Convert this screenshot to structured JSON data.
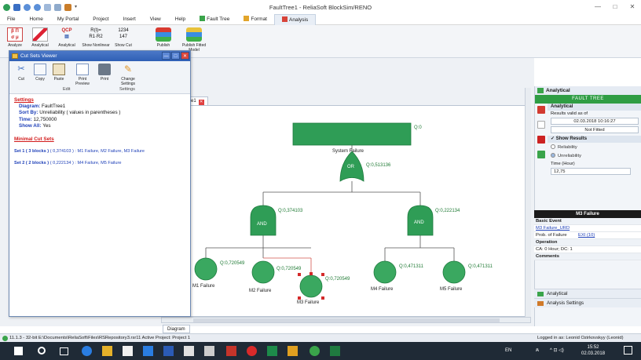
{
  "window": {
    "title": "FaultTree1 - ReliaSoft BlockSim/RENO",
    "minimize": "—",
    "maximize": "□",
    "close": "✕"
  },
  "ribbon_tabs": [
    "File",
    "Home",
    "My Portal",
    "Project",
    "Insert",
    "View",
    "Help",
    "Fault Tree",
    "Format",
    "Analysis"
  ],
  "ribbon": {
    "buttons": [
      "Analyze",
      "Analytical",
      "Analytical",
      "Show Nonlinear",
      "Show Cut",
      "Publish",
      "Publish Fitted Model"
    ],
    "qcp_label": "QCP",
    "formula_top": "R(t)=",
    "formula_bottom": "R1·R2",
    "num_top": "1234",
    "num_bottom": "147"
  },
  "doc_tab": "tree1",
  "doc_tab_close": "✕",
  "bottom_tab": "Diagram",
  "cut_sets_viewer": {
    "title": "Cut Sets Viewer",
    "tools": [
      "Cut",
      "Copy",
      "Paste",
      "Print Preview",
      "Print",
      "Change Settings"
    ],
    "group_edit": "Edit",
    "group_settings": "Settings",
    "settings_header": "Settings",
    "diagram_label": "Diagram:",
    "diagram_value": "FaultTree1",
    "sort_label": "Sort By:",
    "sort_value": "Unreliability ( values in parentheses )",
    "time_label": "Time:",
    "time_value": "12,750000",
    "showall_label": "Show All:",
    "showall_value": "Yes",
    "mcs_header": "Minimal Cut Sets",
    "set1_head": "Set 1 ( 3 blocks )",
    "set1_rest": " ( 0,374103 ) : M1 Failure, M2 Failure, M3 Failure",
    "set2_head": "Set 2 ( 2 blocks )",
    "set2_rest": " ( 0,222134 ) : M4 Failure, M5 Failure"
  },
  "fault_tree": {
    "top_q": "Q:0",
    "top_label": "System Failure",
    "or_label": "OR",
    "or_q": "Q:0,513136",
    "and1_label": "AND",
    "and1_q": "Q:0,374103",
    "and2_label": "AND",
    "and2_q": "Q:0,222134",
    "events": [
      {
        "label": "M1 Failure",
        "q": "Q:0,720549"
      },
      {
        "label": "M2 Failure",
        "q": "Q:0,720549"
      },
      {
        "label": "M3 Failure",
        "q": "Q:0,720549"
      },
      {
        "label": "M4 Failure",
        "q": "Q:0,471311"
      },
      {
        "label": "M5 Failure",
        "q": "Q:0,471311"
      }
    ]
  },
  "right_panel": {
    "header": "Analytical",
    "banner": "FAULT TREE",
    "analytical_sub": "Analytical",
    "results_valid": "Results valid as of",
    "timestamp": "02.03.2018 10:16:27",
    "not_fitted": "Not Fitted",
    "show_results": "Show Results",
    "reliability": "Reliability",
    "unreliability": "Unreliability",
    "time_label": "Time (Hour)",
    "time_value": "12,75"
  },
  "m3_panel": {
    "title": "M3 Failure",
    "basic_event": "Basic Event",
    "model_link": "M3 Failure_URD",
    "prob_label": "Prob. of Failure",
    "prob_value": "EXI (10)",
    "operation": "Operation",
    "ca_line": "CA: 0 Hour; DC: 1",
    "comments": "Comments"
  },
  "right_bottom": {
    "analytical": "Analytical",
    "analysis_settings": "Analysis Settings"
  },
  "status": {
    "left": "11.1.3 - 32-bit   E:\\Documents\\ReliaSoft\\Files\\RSRepository3.rsr11   Active Project: Project 1",
    "right": "Logged in as: Leonid Ozirkovskyy (Leonid)"
  },
  "taskbar": {
    "lang": "EN",
    "time": "15:52",
    "date": "02.03.2018"
  },
  "colors": {
    "gate_green": "#2f9d56",
    "event_green": "#3aa860",
    "accent_blue": "#2f5fb5"
  }
}
